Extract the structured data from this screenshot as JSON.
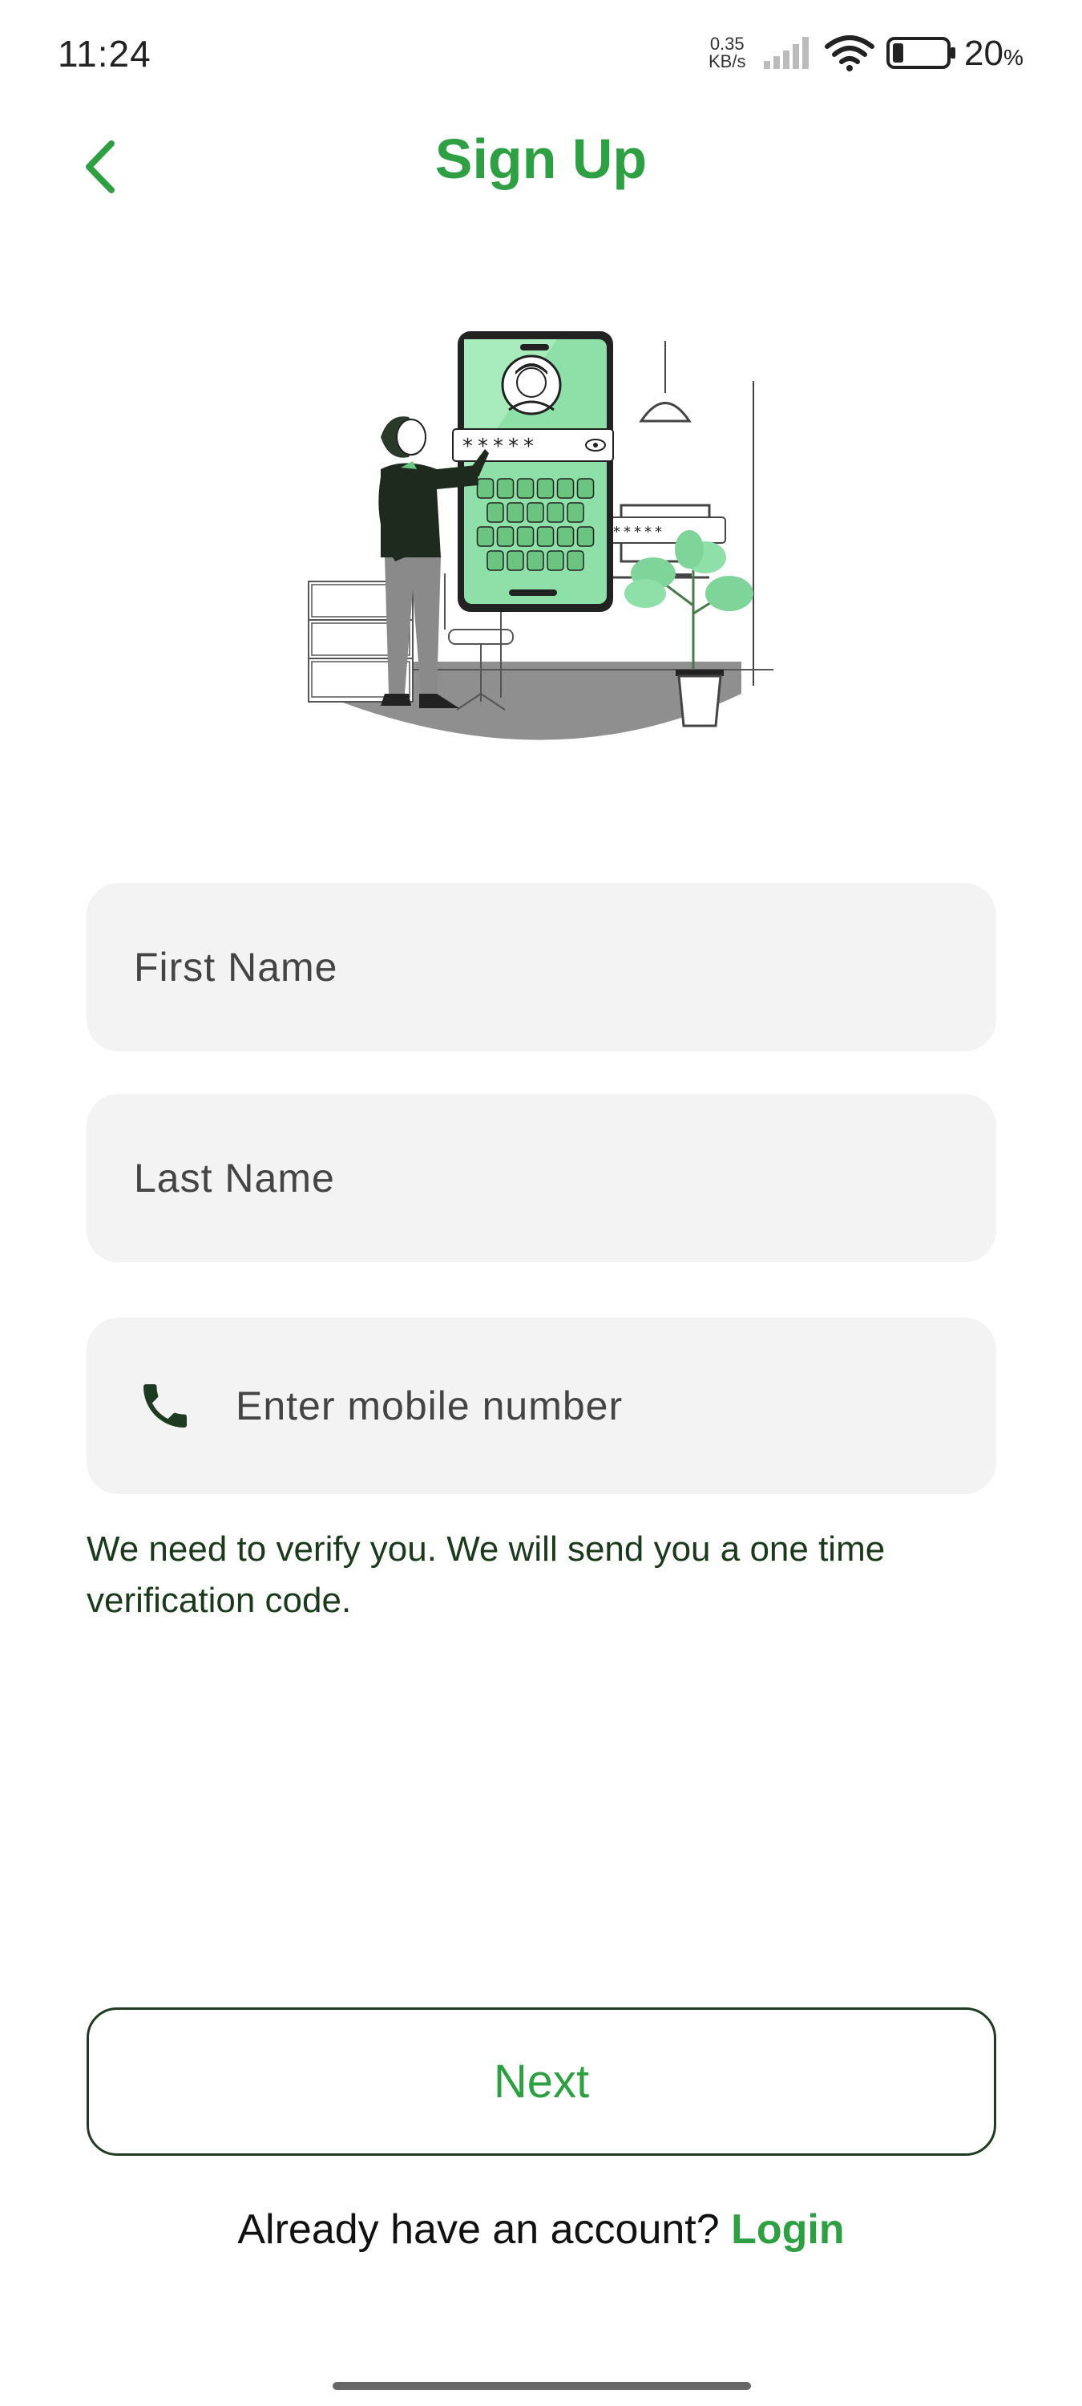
{
  "status_bar": {
    "time": "11:24",
    "net_speed_value": "0.35",
    "net_speed_unit": "KB/s",
    "battery_percent": "20",
    "battery_percent_sign": "%",
    "battery_level": 0.2
  },
  "header": {
    "title": "Sign Up",
    "back_icon": "chevron-left-icon"
  },
  "form": {
    "first_name": {
      "placeholder": "First Name",
      "value": ""
    },
    "last_name": {
      "placeholder": "Last Name",
      "value": ""
    },
    "mobile": {
      "placeholder": "Enter mobile number",
      "value": "",
      "icon": "phone-icon"
    },
    "helper_text": "We need to verify you. We will send you a one time verification code."
  },
  "actions": {
    "next_label": "Next",
    "login_prompt": "Already have an account?",
    "login_link": "Login"
  },
  "illustration": {
    "password_mask_phone": "*****",
    "password_mask_monitor": "*****"
  },
  "colors": {
    "accent": "#2ea043",
    "field_bg": "#f3f3f3",
    "dark_green": "#1e3a20"
  }
}
